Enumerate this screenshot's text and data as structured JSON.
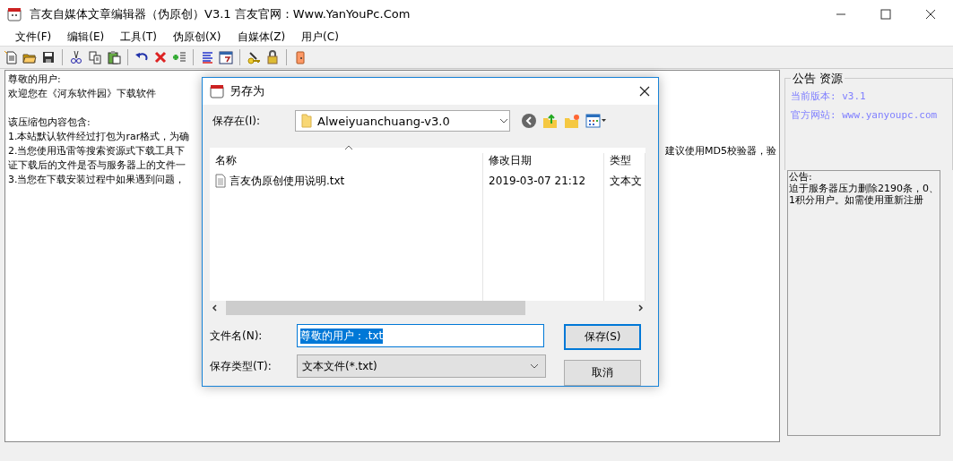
{
  "window": {
    "title": "言友自媒体文章编辑器（伪原创）V3.1 言友官网：Www.YanYouPc.Com"
  },
  "menu": [
    {
      "label": "文件(F)"
    },
    {
      "label": "编辑(E)"
    },
    {
      "label": "工具(T)"
    },
    {
      "label": "伪原创(X)"
    },
    {
      "label": "自媒体(Z)"
    },
    {
      "label": "用户(C)"
    }
  ],
  "editor": {
    "lines": [
      {
        "kind": "text",
        "text": "尊敬的用户:"
      },
      {
        "kind": "text",
        "text": "欢迎您在《河东软件园》下载软件"
      },
      {
        "kind": "blank"
      },
      {
        "kind": "text",
        "text": "该压缩包内容包含:"
      },
      {
        "kind": "text",
        "text": "1.本站默认软件经过打包为rar格式，为确"
      },
      {
        "kind": "text",
        "text": "2.当您使用迅雷等搜索资源式下载工具下",
        "right": "建议使用MD5校验器，验"
      },
      {
        "kind": "text",
        "text": "证下载后的文件是否与服务器上的文件一"
      },
      {
        "kind": "text",
        "text": "3.当您在下载安装过程中如果遇到问题，"
      }
    ]
  },
  "side_panel": {
    "group_title": "公告 资源",
    "version": "当前版本: v3.1",
    "website": "官方网站: www.yanyoupc.com",
    "notice_lines": [
      "公告:",
      "迫于服务器压力删除2190条，0、",
      "1积分用户。如需使用重新注册"
    ]
  },
  "dialog": {
    "title": "另存为",
    "save_in_label": "保存在(I):",
    "folder": "Alweiyuanchuang-v3.0",
    "columns": [
      "名称",
      "修改日期",
      "类型"
    ],
    "files": [
      {
        "name": "言友伪原创使用说明.txt",
        "modified": "2019-03-07 21:12",
        "type": "文本文"
      }
    ],
    "file_name_label": "文件名(N):",
    "file_name": "尊敬的用户：.txt",
    "file_name_selected": true,
    "file_type_label": "保存类型(T):",
    "file_type": "文本文件(*.txt)",
    "buttons": [
      {
        "label": "保存(S)",
        "default": true
      },
      {
        "label": "取消",
        "default": false
      }
    ]
  }
}
